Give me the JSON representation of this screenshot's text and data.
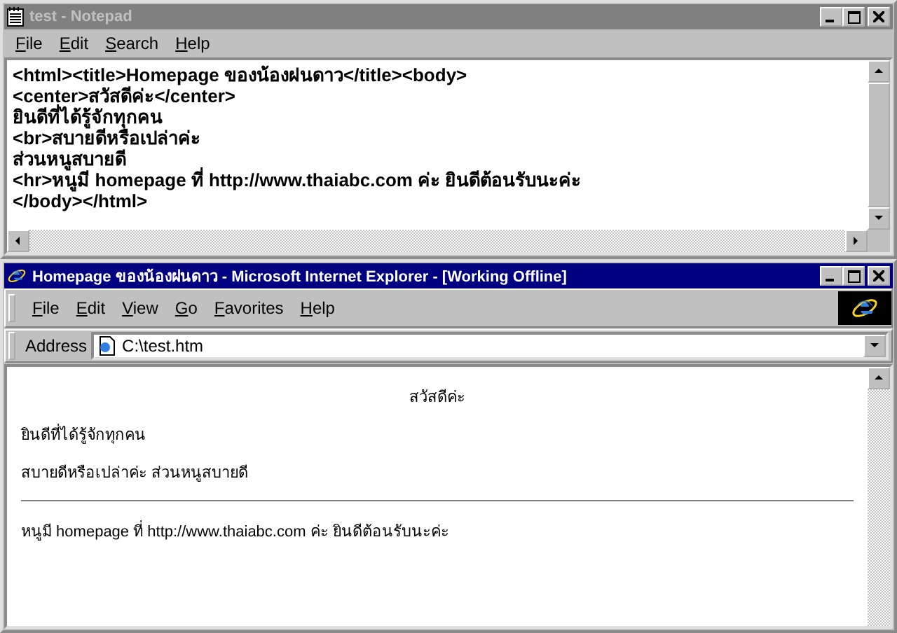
{
  "notepad": {
    "title": "test - Notepad",
    "active": false,
    "menu": [
      "File",
      "Edit",
      "Search",
      "Help"
    ],
    "lines": [
      "<html><title>Homepage ของน้องฝนดาว</title><body>",
      "<center>สวัสดีค่ะ</center>",
      "ยินดีที่ได้รู้จักทุกคน",
      "<br>สบายดีหรือเปล่าค่ะ",
      "ส่วนหนูสบายดี",
      "<hr>หนูมี homepage ที่ http://www.thaiabc.com ค่ะ ยินดีต้อนรับนะค่ะ",
      "</body></html>"
    ]
  },
  "browser": {
    "title": "Homepage ของน้องฝนดาว - Microsoft Internet Explorer - [Working Offline]",
    "active": true,
    "menu": [
      "File",
      "Edit",
      "View",
      "Go",
      "Favorites",
      "Help"
    ],
    "address_label": "Address",
    "address": "C:\\test.htm",
    "page": {
      "heading": "สวัสดีค่ะ",
      "paragraphs": [
        "ยินดีที่ได้รู้จักทุกคน",
        "สบายดีหรือเปล่าค่ะ ส่วนหนูสบายดี"
      ],
      "footer": "หนูมี homepage ที่ http://www.thaiabc.com ค่ะ ยินดีต้อนรับนะค่ะ"
    }
  }
}
